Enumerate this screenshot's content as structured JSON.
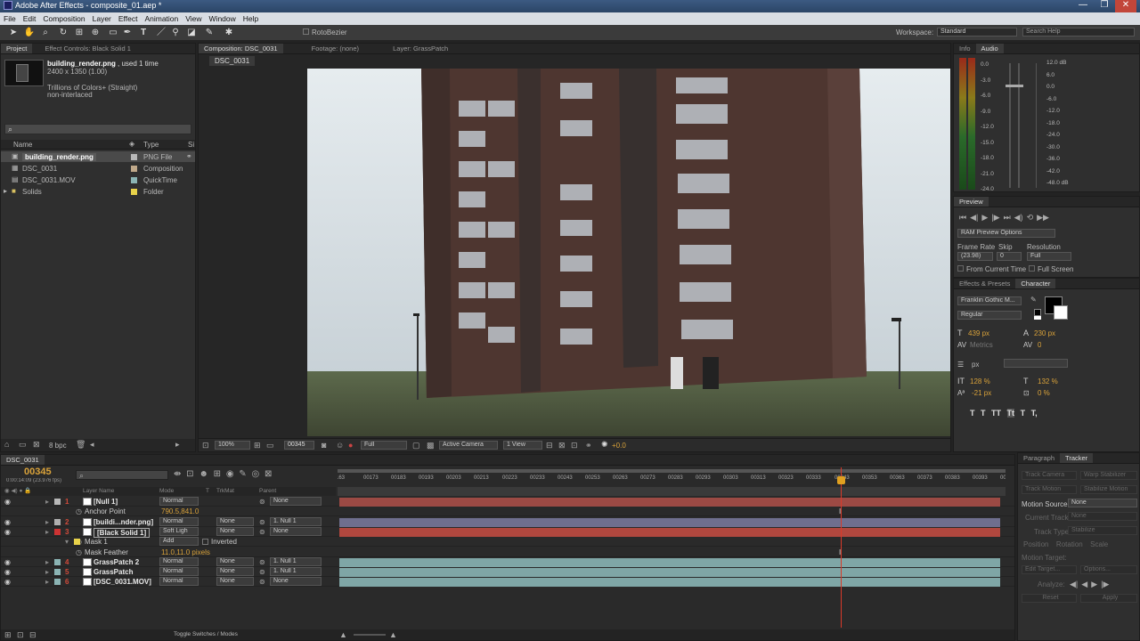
{
  "window": {
    "title": "Adobe After Effects - composite_01.aep *",
    "min": "—",
    "max": "❐",
    "close": "✕"
  },
  "menu": [
    "File",
    "Edit",
    "Composition",
    "Layer",
    "Effect",
    "Animation",
    "View",
    "Window",
    "Help"
  ],
  "toolbar": {
    "roto": "RotoBezier",
    "workspace_label": "Workspace:",
    "workspace_value": "Standard",
    "search_placeholder": "Search Help"
  },
  "project": {
    "tabs": [
      "Project",
      "Effect Controls: Black Solid 1"
    ],
    "item_name": "building_render.png",
    "item_used": ", used 1 time",
    "item_dims": "2400 x 1350 (1.00)",
    "item_colors": "Trillions of Colors+ (Straight)",
    "item_interlace": "non-interlaced",
    "col_name": "Name",
    "col_type": "Type",
    "col_size": "Si",
    "items": [
      {
        "name": "building_render.png",
        "type": "PNG File",
        "color": "#b8b8b8"
      },
      {
        "name": "DSC_0031",
        "type": "Composition",
        "color": "#bfa88a"
      },
      {
        "name": "DSC_0031.MOV",
        "type": "QuickTime",
        "color": "#8bb4b4"
      },
      {
        "name": "Solids",
        "type": "Folder",
        "color": "#e8d24a"
      }
    ],
    "bpc": "8 bpc"
  },
  "viewer": {
    "tabs": [
      "Composition: DSC_0031",
      "Footage: (none)",
      "Layer: GrassPatch"
    ],
    "comp_name": "DSC_0031",
    "zoom": "100%",
    "frame": "00345",
    "resolution": "Full",
    "camera": "Active Camera",
    "views": "1 View",
    "exposure": "+0.0"
  },
  "info": {
    "tabs": [
      "Info",
      "Audio"
    ],
    "left_db": [
      "0.0",
      "-3.0",
      "-6.0",
      "-9.0",
      "-12.0",
      "-15.0",
      "-18.0",
      "-21.0",
      "-24.0"
    ],
    "right_db": [
      "12.0 dB",
      "6.0",
      "0.0",
      "-6.0",
      "-12.0",
      "-18.0",
      "-24.0",
      "-30.0",
      "-36.0",
      "-42.0",
      "-48.0 dB"
    ]
  },
  "preview": {
    "tab": "Preview",
    "ram": "RAM Preview Options",
    "frame_rate": "Frame Rate",
    "skip": "Skip",
    "resolution": "Resolution",
    "fr_value": "(23.98)",
    "skip_value": "0",
    "res_value": "Full",
    "from_current": "From Current Time",
    "full_screen": "Full Screen"
  },
  "character": {
    "tabs": [
      "Effects & Presets",
      "Character"
    ],
    "font": "Franklin Gothic M...",
    "style": "Regular",
    "size": "439 px",
    "leading": "230 px",
    "kerning": "Metrics",
    "tracking": "0",
    "stroke": "px",
    "v_scale": "128 %",
    "h_scale": "132 %",
    "baseline": "-21 px",
    "tsume": "0 %",
    "styles": [
      "T",
      "T",
      "TT",
      "Tt",
      "T",
      "T,"
    ]
  },
  "tracker": {
    "tabs": [
      "Paragraph",
      "Tracker"
    ],
    "track_camera": "Track Camera",
    "warp": "Warp Stabilizer",
    "track_motion": "Track Motion",
    "stabilize": "Stabilize Motion",
    "motion_source_label": "Motion Source:",
    "motion_source": "None",
    "current_track_label": "Current Track:",
    "current_track": "None",
    "track_type_label": "Track Type:",
    "track_type": "Stabilize",
    "position": "Position",
    "rotation": "Rotation",
    "scale": "Scale",
    "motion_target": "Motion Target:",
    "edit_target": "Edit Target...",
    "options": "Options...",
    "analyze": "Analyze:",
    "reset": "Reset",
    "apply": "Apply"
  },
  "timeline": {
    "tab": "DSC_0031",
    "timecode": "00345",
    "timecode_sub": "0:00:14:09 (23.976 fps)",
    "col_layer": "Layer Name",
    "col_mode": "Mode",
    "col_t": "T",
    "col_trkmat": "TrkMat",
    "col_parent": "Parent",
    "ruler": [
      "163",
      "00173",
      "00183",
      "00193",
      "00203",
      "00213",
      "00223",
      "00233",
      "00243",
      "00253",
      "00263",
      "00273",
      "00283",
      "00293",
      "00303",
      "00313",
      "00323",
      "00333",
      "00343",
      "00353",
      "00363",
      "00373",
      "00383",
      "00393",
      "0040"
    ],
    "toggle": "Toggle Switches / Modes",
    "layers": [
      {
        "num": "1",
        "name": "[Null 1]",
        "mode": "Normal",
        "trk": "",
        "parent": "None",
        "color": "#b8b8b8",
        "bar": "#9c4a44"
      },
      {
        "num": "",
        "name": "Anchor Point",
        "value": "790.5,841.0",
        "sub": true
      },
      {
        "num": "2",
        "name": "[buildi...nder.png]",
        "mode": "Normal",
        "trk": "None",
        "parent": "1. Null 1",
        "color": "#b0b0b0",
        "bar": "#6f6f8e"
      },
      {
        "num": "3",
        "name": "[Black Solid 1]",
        "mode": "Soft Ligh",
        "trk": "None",
        "parent": "None",
        "color": "#cc3333",
        "bar": "#b0473e"
      },
      {
        "num": "",
        "name": "Mask 1",
        "mode": "Add",
        "inverted": "Inverted",
        "sub": true
      },
      {
        "num": "",
        "name": "Mask Feather",
        "value": "11.0,11.0 pixels",
        "sub": true
      },
      {
        "num": "4",
        "name": "GrassPatch 2",
        "mode": "Normal",
        "trk": "None",
        "parent": "1. Null 1",
        "color": "#8bb4b4",
        "bar": "#7fa6a6"
      },
      {
        "num": "5",
        "name": "GrassPatch",
        "mode": "Normal",
        "trk": "None",
        "parent": "1. Null 1",
        "color": "#8bb4b4",
        "bar": "#7fa6a6"
      },
      {
        "num": "6",
        "name": "[DSC_0031.MOV]",
        "mode": "Normal",
        "trk": "None",
        "parent": "None",
        "color": "#8bb4b4",
        "bar": "#7fa6a6"
      }
    ]
  }
}
